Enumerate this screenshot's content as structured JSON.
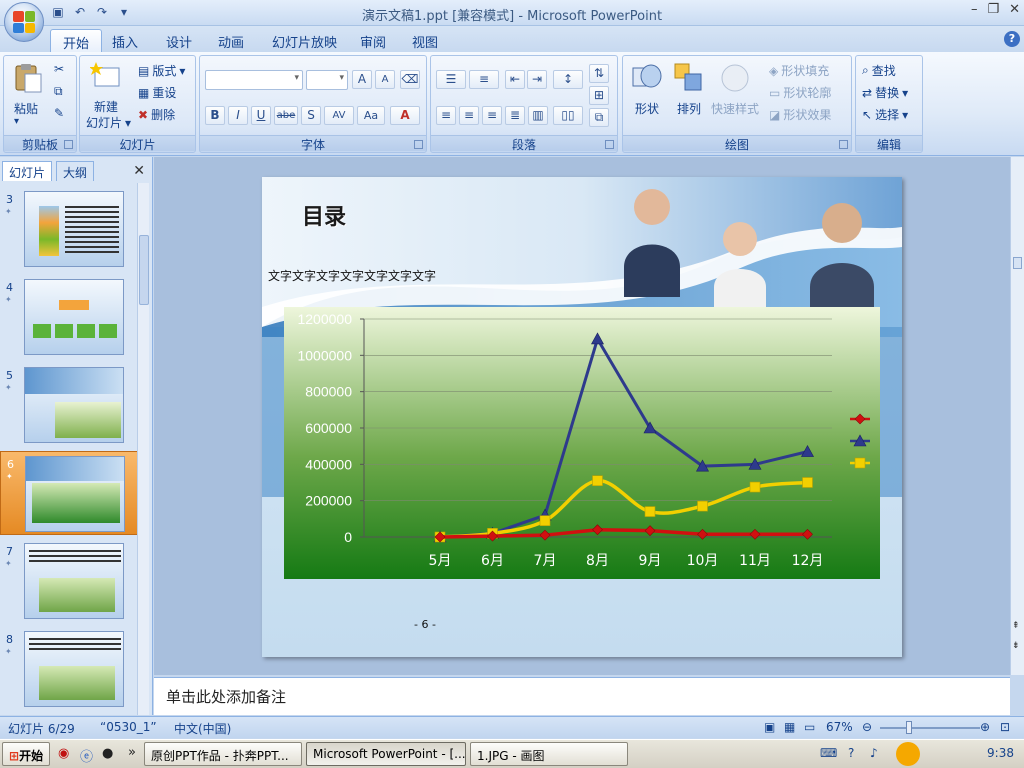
{
  "window": {
    "title": "演示文稿1.ppt [兼容模式] - Microsoft PowerPoint"
  },
  "qat": {
    "save_icon": "save-icon",
    "undo_icon": "undo-icon",
    "redo_icon": "redo-icon"
  },
  "tabs": [
    {
      "label": "开始"
    },
    {
      "label": "插入"
    },
    {
      "label": "设计"
    },
    {
      "label": "动画"
    },
    {
      "label": "幻灯片放映"
    },
    {
      "label": "审阅"
    },
    {
      "label": "视图"
    }
  ],
  "ribbon": {
    "clipboard": {
      "label": "剪贴板",
      "paste": "粘贴"
    },
    "slides": {
      "label": "幻灯片",
      "new_slide": "新建",
      "new_slide2": "幻灯片",
      "layout": "版式",
      "reset": "重设",
      "delete": "删除"
    },
    "font": {
      "label": "字体",
      "grow": "A",
      "shrink": "A",
      "bold": "B",
      "italic": "I",
      "underline": "U",
      "strike": "abe",
      "shadow": "S",
      "spacing": "AV",
      "case": "Aa",
      "color": "A"
    },
    "paragraph": {
      "label": "段落"
    },
    "drawing": {
      "label": "绘图",
      "shapes": "形状",
      "arrange": "排列",
      "quick_styles": "快速样式",
      "fill": "形状填充",
      "outline": "形状轮廓",
      "effects": "形状效果"
    },
    "editing": {
      "label": "编辑",
      "find": "查找",
      "replace": "替换",
      "select": "选择"
    }
  },
  "left_panel": {
    "tab_slides": "幻灯片",
    "tab_outline": "大纲",
    "thumbnails": [
      {
        "num": "3"
      },
      {
        "num": "4"
      },
      {
        "num": "5"
      },
      {
        "num": "6"
      },
      {
        "num": "7"
      },
      {
        "num": "8"
      }
    ]
  },
  "slide": {
    "title": "目录",
    "subtitle": "文字文字文字文字文字文字文字",
    "page_number": "- 6 -"
  },
  "chart_data": {
    "type": "line",
    "categories": [
      "5月",
      "6月",
      "7月",
      "8月",
      "9月",
      "10月",
      "11月",
      "12月"
    ],
    "yticks": [
      "1200000",
      "1000000",
      "800000",
      "600000",
      "400000",
      "200000",
      "0"
    ],
    "ylim": [
      0,
      1200000
    ],
    "grid": true,
    "legend_position": "right",
    "series": [
      {
        "color": "#d01010",
        "marker": "diamond",
        "values": [
          0,
          5000,
          10000,
          40000,
          35000,
          15000,
          15000,
          15000
        ]
      },
      {
        "color": "#2e3a8c",
        "marker": "triangle",
        "values": [
          0,
          20000,
          120000,
          1090000,
          600000,
          390000,
          400000,
          470000
        ]
      },
      {
        "color": "#f2d000",
        "marker": "square",
        "values": [
          0,
          20000,
          90000,
          310000,
          140000,
          170000,
          275000,
          300000
        ]
      }
    ]
  },
  "notes": {
    "placeholder": "单击此处添加备注"
  },
  "status": {
    "slide_info": "幻灯片 6/29",
    "theme": "“0530_1”",
    "language": "中文(中国)",
    "zoom": "67%"
  },
  "taskbar": {
    "start": "开始",
    "items": [
      {
        "label": "原创PPT作品 - 扑奔PPT..."
      },
      {
        "label": "Microsoft PowerPoint - [..."
      },
      {
        "label": "1.JPG - 画图"
      }
    ],
    "clock": "9:38"
  }
}
